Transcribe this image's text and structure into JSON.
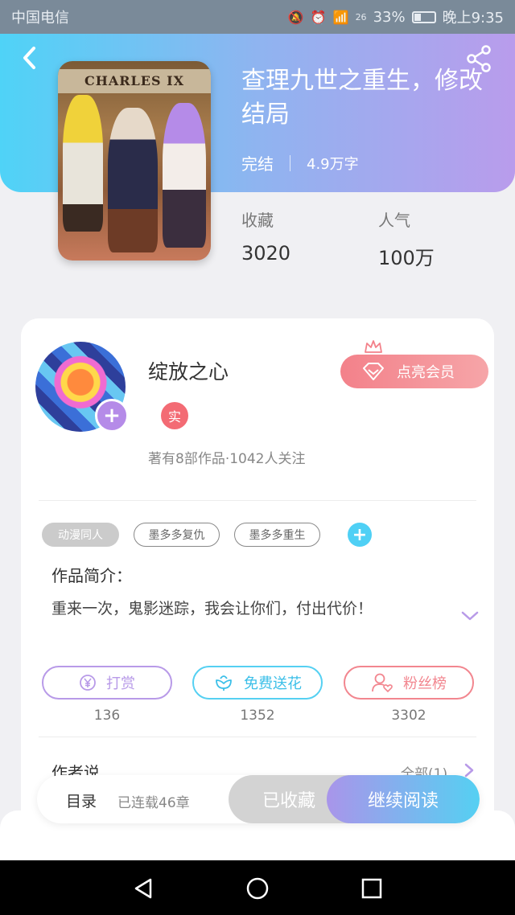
{
  "status_bar": {
    "carrier": "中国电信",
    "network": "26",
    "battery": "33%",
    "time": "晚上9:35"
  },
  "book": {
    "title": "查理九世之重生，修改结局",
    "cover_text": "CHARLES IX",
    "status": "完结",
    "word_count": "4.9万字",
    "collect_label": "收藏",
    "collect_value": "3020",
    "popularity_label": "人气",
    "popularity_value": "100万"
  },
  "author": {
    "name": "绽放之心",
    "verified_badge": "实",
    "info": "著有8部作品·1042人关注",
    "vip_button": "点亮会员"
  },
  "tags": [
    "动漫同人",
    "墨多多复仇",
    "墨多多重生"
  ],
  "intro": {
    "heading": "作品简介：",
    "text": "重来一次，鬼影迷踪，我会让你们，付出代价！"
  },
  "actions": [
    {
      "label": "打赏",
      "count": "136"
    },
    {
      "label": "免费送花",
      "count": "1352"
    },
    {
      "label": "粉丝榜",
      "count": "3302"
    }
  ],
  "author_says": {
    "heading": "作者说",
    "see_all": "全部(1)"
  },
  "bottom_bar": {
    "toc": "目录",
    "serial": "已连载46章",
    "collected": "已收藏",
    "continue": "继续阅读"
  },
  "colors": {
    "gradient_start": "#4fd3f7",
    "gradient_end": "#b99cec",
    "vip_pink": "#f3818a",
    "accent_cyan": "#4fd0f5"
  }
}
